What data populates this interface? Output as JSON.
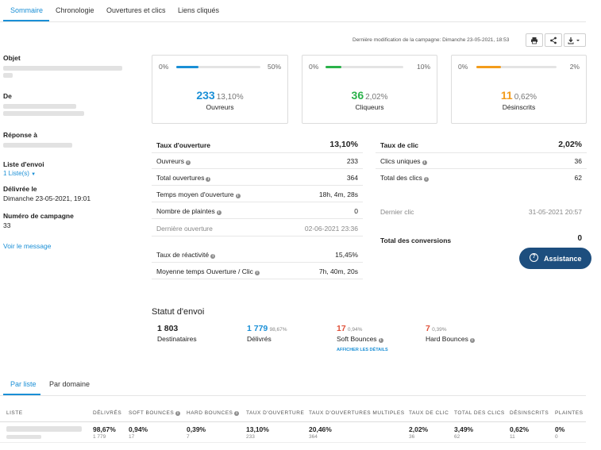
{
  "tabs": [
    "Sommaire",
    "Chronologie",
    "Ouvertures et clics",
    "Liens cliqués"
  ],
  "header": {
    "last_modified_label": "Dernière modification de la campagne:",
    "last_modified_value": "Dimanche 23-05-2021, 18:53"
  },
  "left": {
    "objet_label": "Objet",
    "de_label": "De",
    "reponse_label": "Réponse à",
    "liste_label": "Liste d'envoi",
    "liste_value": "1 Liste(s)",
    "delivree_label": "Délivrée le",
    "delivree_value": "Dimanche 23-05-2021, 19:01",
    "numero_label": "Numéro de campagne",
    "numero_value": "33",
    "voir_message": "Voir le message"
  },
  "cards": [
    {
      "min": "0%",
      "max": "50%",
      "fill": 0.262,
      "color": "#1a8fd6",
      "value": "233",
      "pct": "13,10%",
      "label": "Ouvreurs"
    },
    {
      "min": "0%",
      "max": "10%",
      "fill": 0.202,
      "color": "#2ab24a",
      "value": "36",
      "pct": "2,02%",
      "label": "Cliqueurs"
    },
    {
      "min": "0%",
      "max": "2%",
      "fill": 0.31,
      "color": "#f39c1b",
      "value": "11",
      "pct": "0,62%",
      "label": "Désinscrits"
    }
  ],
  "open_stats": {
    "head_label": "Taux d'ouverture",
    "head_value": "13,10%",
    "rows": [
      {
        "label": "Ouvreurs",
        "value": "233"
      },
      {
        "label": "Total ouvertures",
        "value": "364"
      },
      {
        "label": "Temps moyen d'ouverture",
        "value": "18h, 4m, 28s"
      },
      {
        "label": "Nombre de plaintes",
        "value": "0"
      },
      {
        "label": "Dernière ouverture",
        "value": "02-06-2021 23:36"
      },
      {
        "label": "Taux de réactivité",
        "value": "15,45%"
      },
      {
        "label": "Moyenne temps Ouverture / Clic",
        "value": "7h, 40m, 20s"
      }
    ]
  },
  "click_stats": {
    "head_label": "Taux de clic",
    "head_value": "2,02%",
    "rows": [
      {
        "label": "Clics uniques",
        "value": "36"
      },
      {
        "label": "Total des clics",
        "value": "62"
      },
      {
        "label": "Dernier clic",
        "value": "31-05-2021 20:57"
      },
      {
        "label": "Total des conversions",
        "value": "0"
      }
    ]
  },
  "assistance_label": "Assistance",
  "envoi": {
    "title": "Statut d'envoi",
    "destinataires_value": "1 803",
    "destinataires_label": "Destinataires",
    "delivres_value": "1 779",
    "delivres_pct": "98,67%",
    "delivres_label": "Délivrés",
    "soft_value": "17",
    "soft_pct": "0,94%",
    "soft_label": "Soft Bounces",
    "hard_value": "7",
    "hard_pct": "0,39%",
    "hard_label": "Hard Bounces",
    "details_link": "AFFICHER LES DÉTAILS"
  },
  "bottom_tabs": [
    "Par liste",
    "Par domaine"
  ],
  "table": {
    "headers": [
      "LISTE",
      "DÉLIVRÉS",
      "SOFT BOUNCES",
      "HARD BOUNCES",
      "TAUX D'OUVERTURE",
      "TAUX D'OUVERTURES MULTIPLES",
      "TAUX DE CLIC",
      "TOTAL DES CLICS",
      "DÉSINSCRITS",
      "PLAINTES"
    ],
    "row": [
      "98,67%",
      "0,94%",
      "0,39%",
      "13,10%",
      "20,46%",
      "2,02%",
      "3,49%",
      "0,62%",
      "0%"
    ],
    "subrow": [
      "1 779",
      "17",
      "7",
      "233",
      "364",
      "36",
      "62",
      "11",
      "0"
    ]
  },
  "colors": {
    "accent": "#1a8fd6",
    "green": "#2ab24a",
    "orange": "#f39c1b",
    "red": "#e0523b",
    "assist_bg": "#1d4e7e"
  }
}
